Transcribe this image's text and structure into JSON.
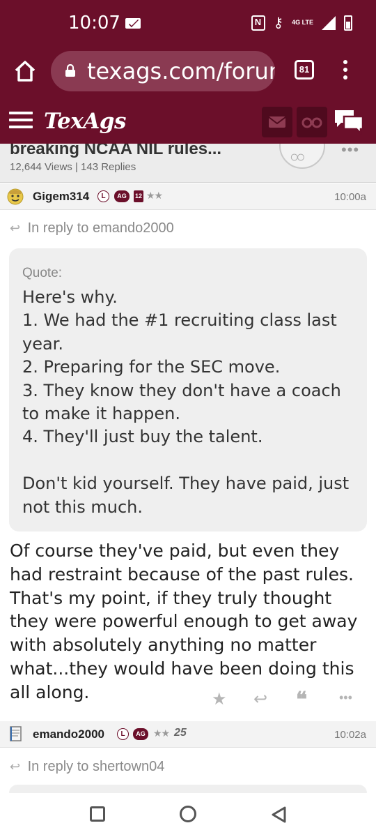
{
  "status": {
    "time": "10:07",
    "network": "4G LTE",
    "icons": [
      "mail-icon",
      "nfc-icon",
      "key-icon",
      "signal-icon",
      "battery-icon"
    ]
  },
  "browser": {
    "url": "texags.com/forum",
    "tab_count": "81"
  },
  "site": {
    "logo": "TexAgs",
    "colors": {
      "brand": "#6b0f2a",
      "brand_dark": "#4f0a1e"
    }
  },
  "thread": {
    "title": "breaking NCAA NIL rules...",
    "meta": "12,644 Views | 143 Replies",
    "more": "•••"
  },
  "posts": [
    {
      "username": "Gigem314",
      "badge_l": "L",
      "badge_ag": "AG",
      "badge_year": "12",
      "stars": "★★",
      "time": "10:00a",
      "reply_to": "In reply to emando2000",
      "quote_label": "Quote:",
      "quote_text": "Here's why.\n1. We had the #1 recruiting class last year.\n2. Preparing for the SEC move.\n3. They know they don't have a coach to make it happen.\n4. They'll just buy the talent.\n\nDon't kid yourself. They have paid, just not this much.",
      "body": "Of course they've paid, but even they had restraint because of the past rules. That's my point, if they truly thought they were powerful enough to get away with absolutely anything no matter what...they would have been doing this all along."
    },
    {
      "username": "emando2000",
      "badge_l": "L",
      "badge_ag": "AG",
      "stars": "★★",
      "badge_25": "25",
      "time": "10:02a",
      "reply_to": "In reply to shertown04"
    }
  ],
  "actions": [
    "star-icon",
    "reply-icon",
    "quote-icon",
    "more-icon"
  ]
}
